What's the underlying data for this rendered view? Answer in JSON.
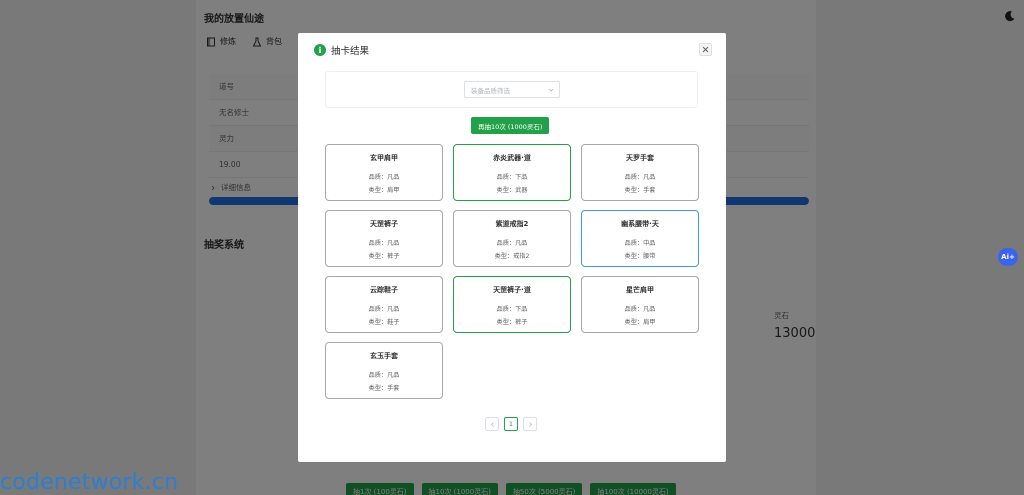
{
  "page": {
    "title": "我的放置仙途",
    "tabs": [
      {
        "label": "修炼",
        "icon": "book-icon"
      },
      {
        "label": "背包",
        "icon": "flask-icon"
      }
    ],
    "table_rows": [
      "道号",
      "无名修士",
      "灵力",
      "19.00"
    ],
    "details_label": "详细信息",
    "progress": 1.0,
    "section_title": "抽奖系统",
    "stone_label": "灵石",
    "stone_value": "13000",
    "draw_buttons": [
      "抽1次 (100灵石)",
      "抽10次 (1000灵石)",
      "抽50次 (5000灵石)",
      "抽100次 (10000灵石)"
    ]
  },
  "dialog": {
    "title": "抽卡结果",
    "filter_placeholder": "装备品质筛选",
    "draw_again": "再抽10次 (1000灵石)",
    "quality_prefix": "品质：",
    "type_prefix": "类型：",
    "cards": [
      {
        "name": "玄甲肩甲",
        "quality": "凡品",
        "type": "肩甲",
        "border": "gray"
      },
      {
        "name": "赤炎武器·道",
        "quality": "下品",
        "type": "武器",
        "border": "green"
      },
      {
        "name": "天罗手套",
        "quality": "凡品",
        "type": "手套",
        "border": "gray"
      },
      {
        "name": "天罡裤子",
        "quality": "凡品",
        "type": "裤子",
        "border": "gray"
      },
      {
        "name": "紫道戒指2",
        "quality": "凡品",
        "type": "戒指2",
        "border": "gray"
      },
      {
        "name": "幽系腰带·天",
        "quality": "中品",
        "type": "腰带",
        "border": "blue"
      },
      {
        "name": "云踪鞋子",
        "quality": "凡品",
        "type": "鞋子",
        "border": "gray"
      },
      {
        "name": "天罡裤子·道",
        "quality": "下品",
        "type": "裤子",
        "border": "green"
      },
      {
        "name": "星芒肩甲",
        "quality": "凡品",
        "type": "肩甲",
        "border": "gray"
      },
      {
        "name": "玄玉手套",
        "quality": "凡品",
        "type": "手套",
        "border": "gray"
      }
    ],
    "pagination": {
      "current": "1"
    }
  },
  "watermark": "codenetwork.cn",
  "ai_badge": "Ai+",
  "colors": {
    "accent": "#23a14a",
    "blue": "#3e9be8",
    "gray": "#a8a8a8"
  }
}
